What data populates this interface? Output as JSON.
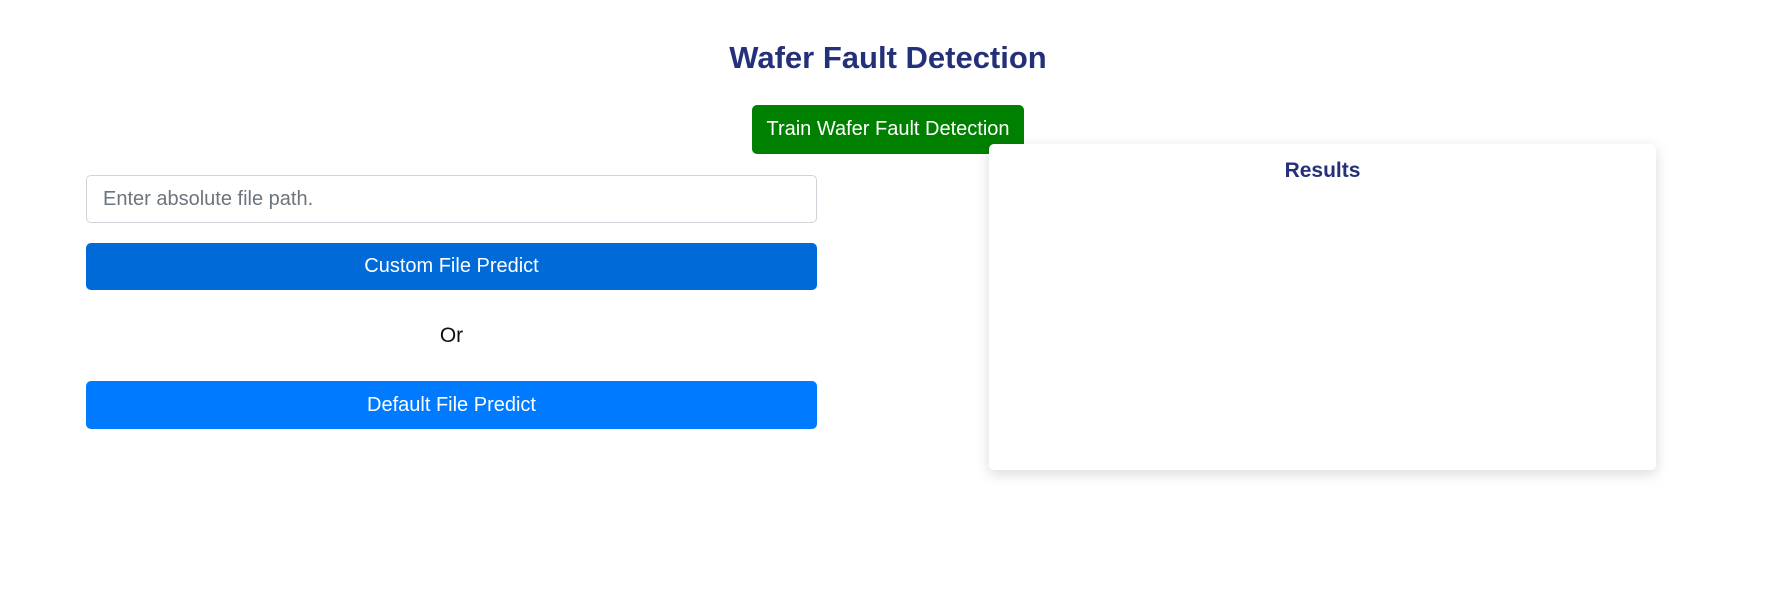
{
  "header": {
    "title": "Wafer Fault Detection"
  },
  "train": {
    "label": "Train Wafer Fault Detection"
  },
  "predict_form": {
    "path_placeholder": "Enter absolute file path.",
    "path_value": "",
    "custom_label": "Custom File Predict",
    "separator": "Or",
    "default_label": "Default File Predict"
  },
  "results": {
    "title": "Results",
    "content": ""
  },
  "colors": {
    "title": "#24307a",
    "train_button": "#008000",
    "custom_button": "#006ad9",
    "default_button": "#007bff"
  }
}
